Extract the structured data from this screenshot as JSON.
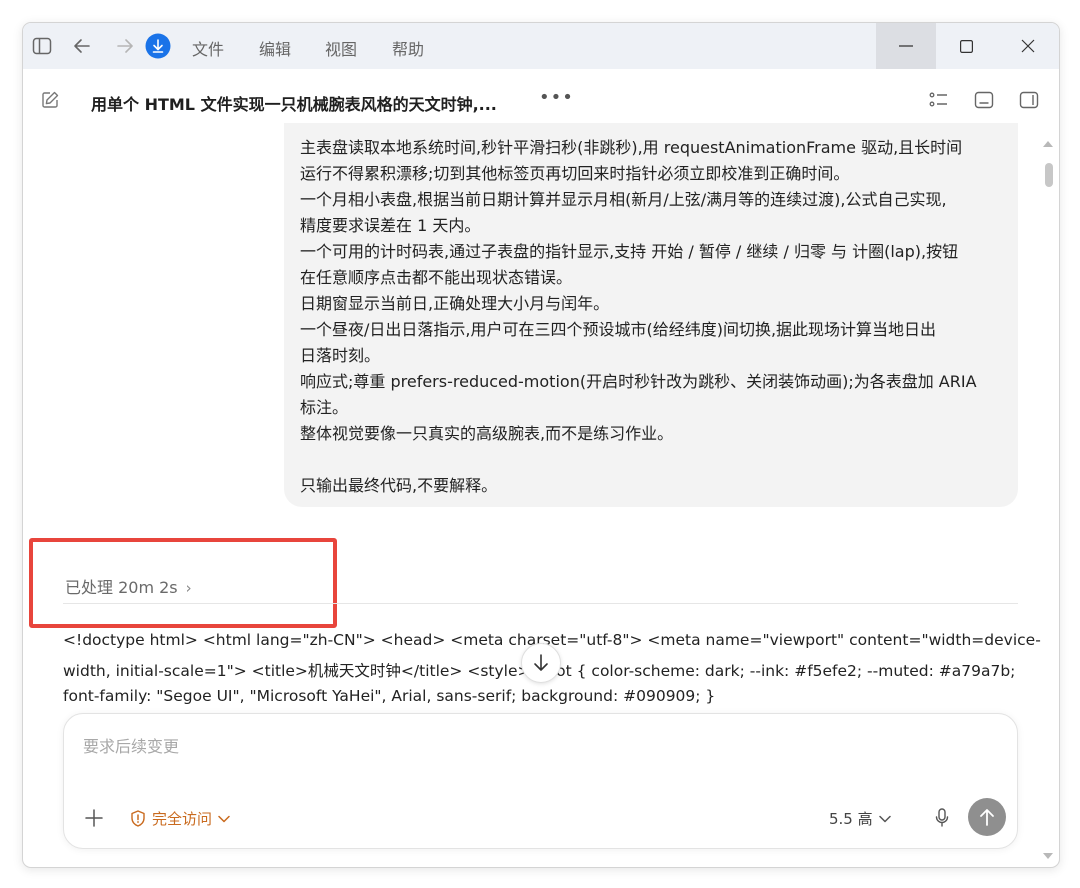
{
  "menu": {
    "file": "文件",
    "edit": "编辑",
    "view": "视图",
    "help": "帮助"
  },
  "header": {
    "title": "用单个 HTML 文件实现一只机械腕表风格的天文时钟,...",
    "more": "•••"
  },
  "message": {
    "lines": [
      "主表盘读取本地系统时间,秒针平滑扫秒(非跳秒),用 requestAnimationFrame 驱动,且长时间",
      "运行不得累积漂移;切到其他标签页再切回来时指针必须立即校准到正确时间。",
      "一个月相小表盘,根据当前日期计算并显示月相(新月/上弦/满月等的连续过渡),公式自己实现,",
      "精度要求误差在 1 天内。",
      "一个可用的计时码表,通过子表盘的指针显示,支持 开始 / 暂停 / 继续 / 归零 与 计圈(lap),按钮",
      "在任意顺序点击都不能出现状态错误。",
      "日期窗显示当前日,正确处理大小月与闰年。",
      "一个昼夜/日出日落指示,用户可在三四个预设城市(给经纬度)间切换,据此现场计算当地日出",
      "日落时刻。",
      "响应式;尊重 prefers-reduced-motion(开启时秒针改为跳秒、关闭装饰动画);为各表盘加 ARIA",
      "标注。",
      "整体视觉要像一只真实的高级腕表,而不是练习作业。",
      "",
      "只输出最终代码,不要解释。"
    ]
  },
  "processed": {
    "label": "已处理 20m 2s",
    "chevron": "›"
  },
  "code": {
    "lines": [
      "<!doctype html> <html lang=\"zh-CN\"> <head> <meta charset=\"utf-8\"> <meta name=\"viewport\" content=\"width=device-",
      "width, initial-scale=1\"> <title>机械天文时钟</title> <style> :root { color-scheme: dark; --ink: #f5efe2; --muted: #a79a7b;",
      "font-family: \"Segoe UI\", \"Microsoft YaHei\", Arial, sans-serif; background: #090909; }"
    ]
  },
  "composer": {
    "placeholder": "要求后续变更",
    "access_label": "完全访问",
    "model_label": "5.5 高"
  },
  "colors": {
    "accent_orange": "#c96a1e",
    "highlight_red": "#e8453c",
    "download_blue": "#1a73e8"
  }
}
